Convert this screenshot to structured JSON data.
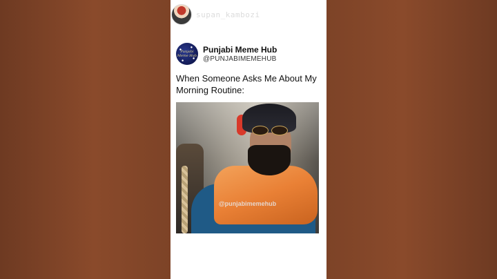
{
  "channel": {
    "username": "supan_kambozi"
  },
  "tweet": {
    "display_name": "Punjabi Meme Hub",
    "handle": "@PUNJABIMEMEHUB",
    "text": "When Someone Asks Me About My Morning Routine:",
    "media_watermark": "@punjabimemehub",
    "avatar_logo_text": "Punjabi Meme Hub"
  },
  "colors": {
    "background_side": "#8a4a2b",
    "card_background": "#ffffff",
    "scarf_orange": "#e98035"
  }
}
